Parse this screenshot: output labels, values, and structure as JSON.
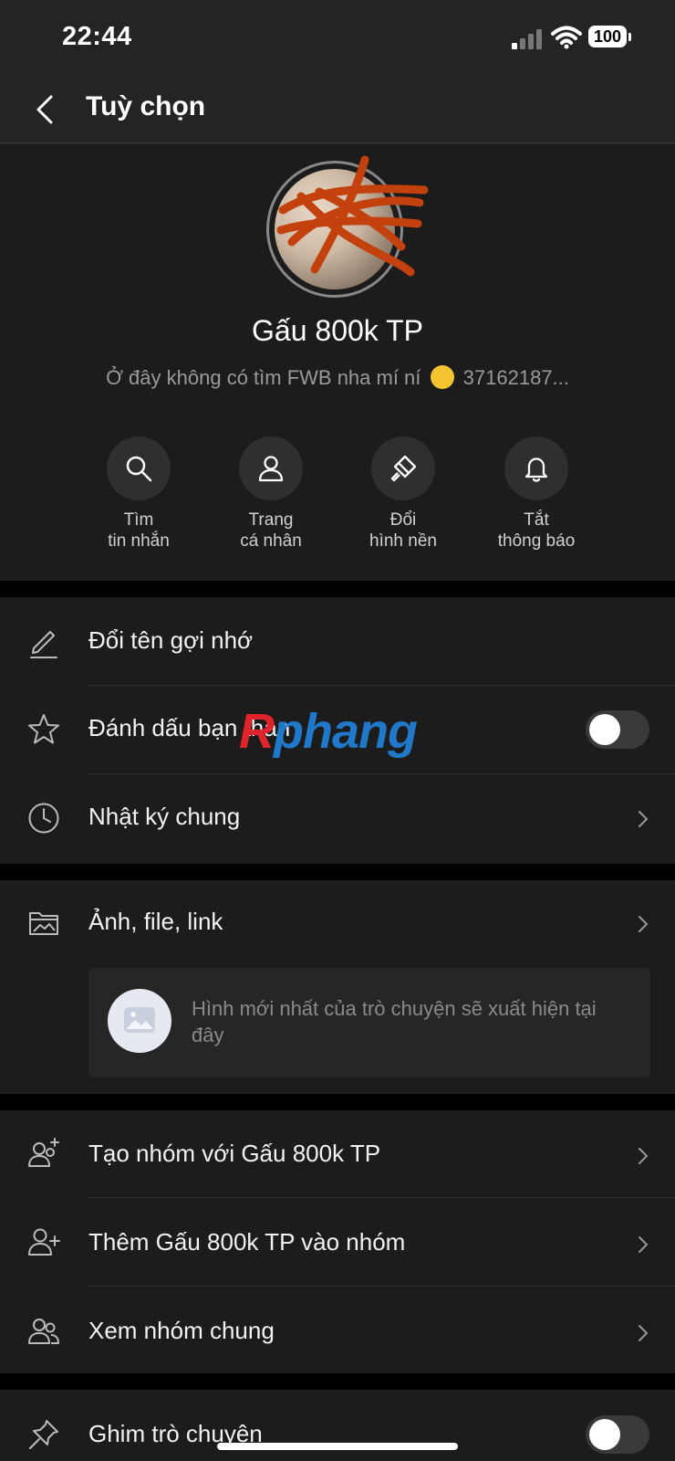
{
  "status_bar": {
    "time": "22:44",
    "battery": "100"
  },
  "header": {
    "title": "Tuỳ chọn"
  },
  "profile": {
    "name": "Gấu 800k TP",
    "status_before_emoji": "Ở đây không có tìm FWB nha mí ní",
    "status_after_emoji": "37162187..."
  },
  "quick_actions": [
    {
      "icon": "search-icon",
      "line1": "Tìm",
      "line2": "tin nhắn"
    },
    {
      "icon": "person-icon",
      "line1": "Trang",
      "line2": "cá nhân"
    },
    {
      "icon": "paintbrush-icon",
      "line1": "Đổi",
      "line2": "hình nền"
    },
    {
      "icon": "bell-icon",
      "line1": "Tắt",
      "line2": "thông báo"
    }
  ],
  "menu": {
    "rename": "Đổi tên gợi nhớ",
    "best_friend": "Đánh dấu bạn thân",
    "diary": "Nhật ký chung",
    "media": "Ảnh, file, link",
    "media_placeholder": "Hình mới nhất của trò chuyện sẽ xuất hiện tại đây",
    "create_group": "Tạo nhóm với Gấu 800k TP",
    "add_to_group": "Thêm Gấu 800k TP vào nhóm",
    "common_groups": "Xem nhóm chung",
    "pin_chat": "Ghim trò chuyện"
  },
  "toggles": {
    "best_friend": false,
    "pin_chat": false
  },
  "watermark": {
    "part1": "R",
    "part2": "phang",
    "color1": "#e0242c",
    "color2": "#1f78c8"
  },
  "colors": {
    "background": "#000000",
    "surface": "#1c1c1c",
    "header": "#242424",
    "scribble": "#c2410c"
  }
}
